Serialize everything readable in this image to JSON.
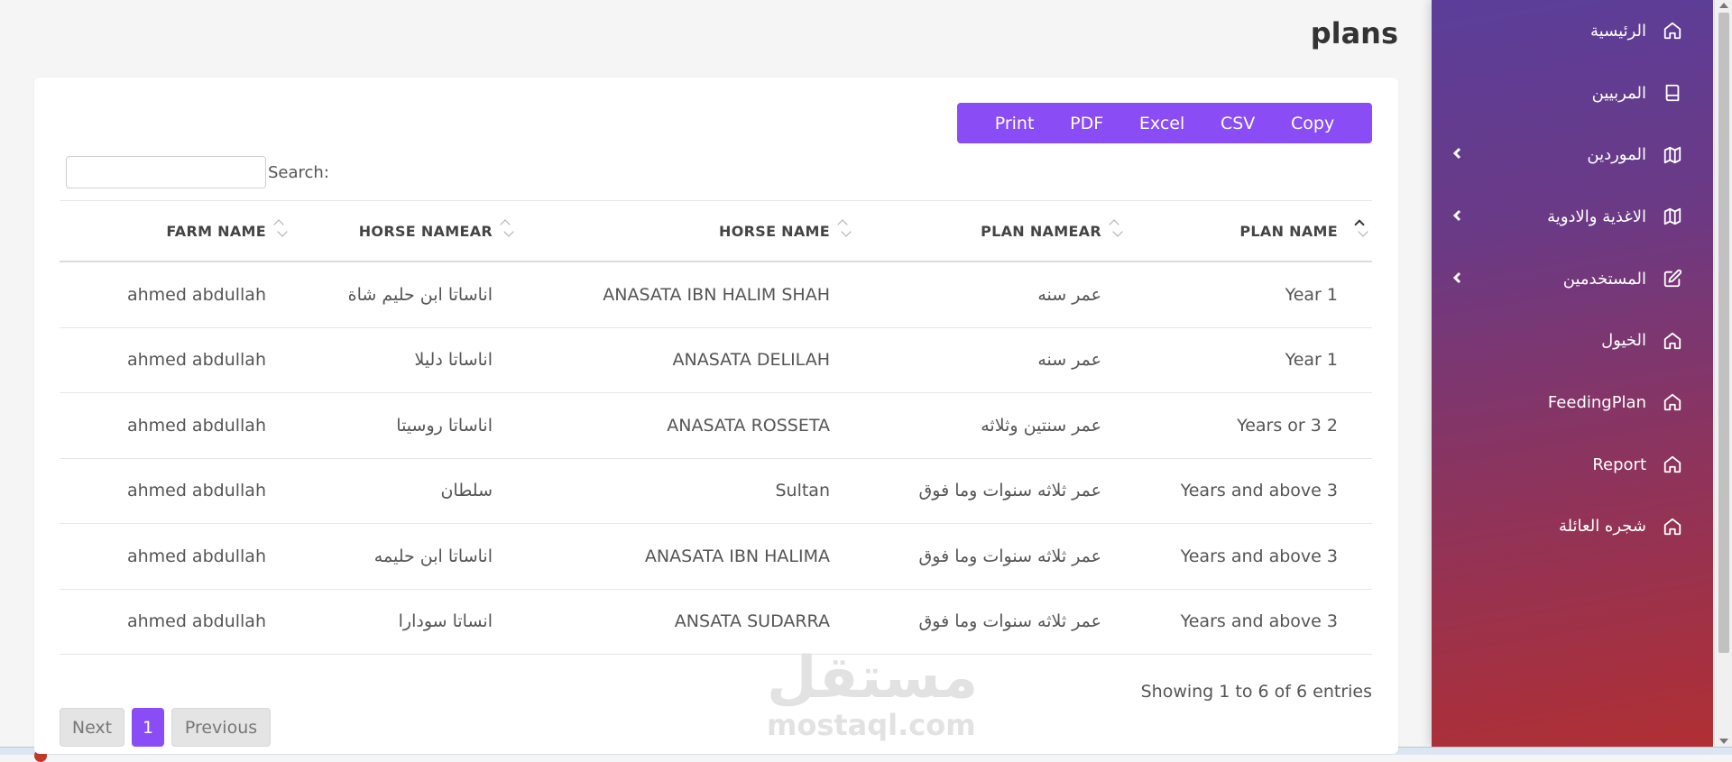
{
  "page": {
    "title": "plans"
  },
  "sidebar": {
    "items": [
      {
        "label": "الرئيسية",
        "icon": "home-icon",
        "has_chevron": false
      },
      {
        "label": "المربيين",
        "icon": "book-icon",
        "has_chevron": false
      },
      {
        "label": "الموردين",
        "icon": "map-icon",
        "has_chevron": true
      },
      {
        "label": "الاغذية والادوية",
        "icon": "map-icon",
        "has_chevron": true
      },
      {
        "label": "المستخدمين",
        "icon": "edit-icon",
        "has_chevron": true
      },
      {
        "label": "الخيول",
        "icon": "home-icon",
        "has_chevron": false
      },
      {
        "label": "FeedingPlan",
        "icon": "home-icon",
        "has_chevron": false
      },
      {
        "label": "Report",
        "icon": "home-icon",
        "has_chevron": false
      },
      {
        "label": "شجره العائلة",
        "icon": "home-icon",
        "has_chevron": false
      }
    ]
  },
  "toolbar": {
    "buttons": [
      "Print",
      "PDF",
      "Excel",
      "CSV",
      "Copy"
    ]
  },
  "search": {
    "label": "Search:",
    "value": "",
    "placeholder": ""
  },
  "table": {
    "columns": [
      "FARM NAME",
      "HORSE NAMEAR",
      "HORSE NAME",
      "PLAN NAMEAR",
      "PLAN NAME"
    ],
    "rows": [
      [
        "ahmed abdullah",
        "اناساتا ابن حليم شاة",
        "ANASATA IBN HALIM SHAH",
        "عمر سنه",
        "Year 1"
      ],
      [
        "ahmed abdullah",
        "اناساتا دليلا",
        "ANASATA DELILAH",
        "عمر سنه",
        "Year 1"
      ],
      [
        "ahmed abdullah",
        "اناساتا روسيتا",
        "ANASATA ROSSETA",
        "عمر سنتين وثلاثه",
        "Years or 3 2"
      ],
      [
        "ahmed abdullah",
        "سلطان",
        "Sultan",
        "عمر ثلاثه سنوات وما فوق",
        "Years and above 3"
      ],
      [
        "ahmed abdullah",
        "اناساتا ابن حليمه",
        "ANASATA IBN HALIMA",
        "عمر ثلاثه سنوات وما فوق",
        "Years and above 3"
      ],
      [
        "ahmed abdullah",
        "انساتا سودارا",
        "ANSATA SUDARRA",
        "عمر ثلاثه سنوات وما فوق",
        "Years and above 3"
      ]
    ]
  },
  "info": "Showing 1 to 6 of 6 entries",
  "pagination": {
    "next": "Next",
    "current": "1",
    "previous": "Previous"
  },
  "watermark": {
    "arabic": "مستقل",
    "latin": "mostaql.com"
  },
  "colors": {
    "accent": "#8a4df5",
    "sidebar_top": "#5b3e9a",
    "sidebar_bottom": "#b02f33"
  }
}
